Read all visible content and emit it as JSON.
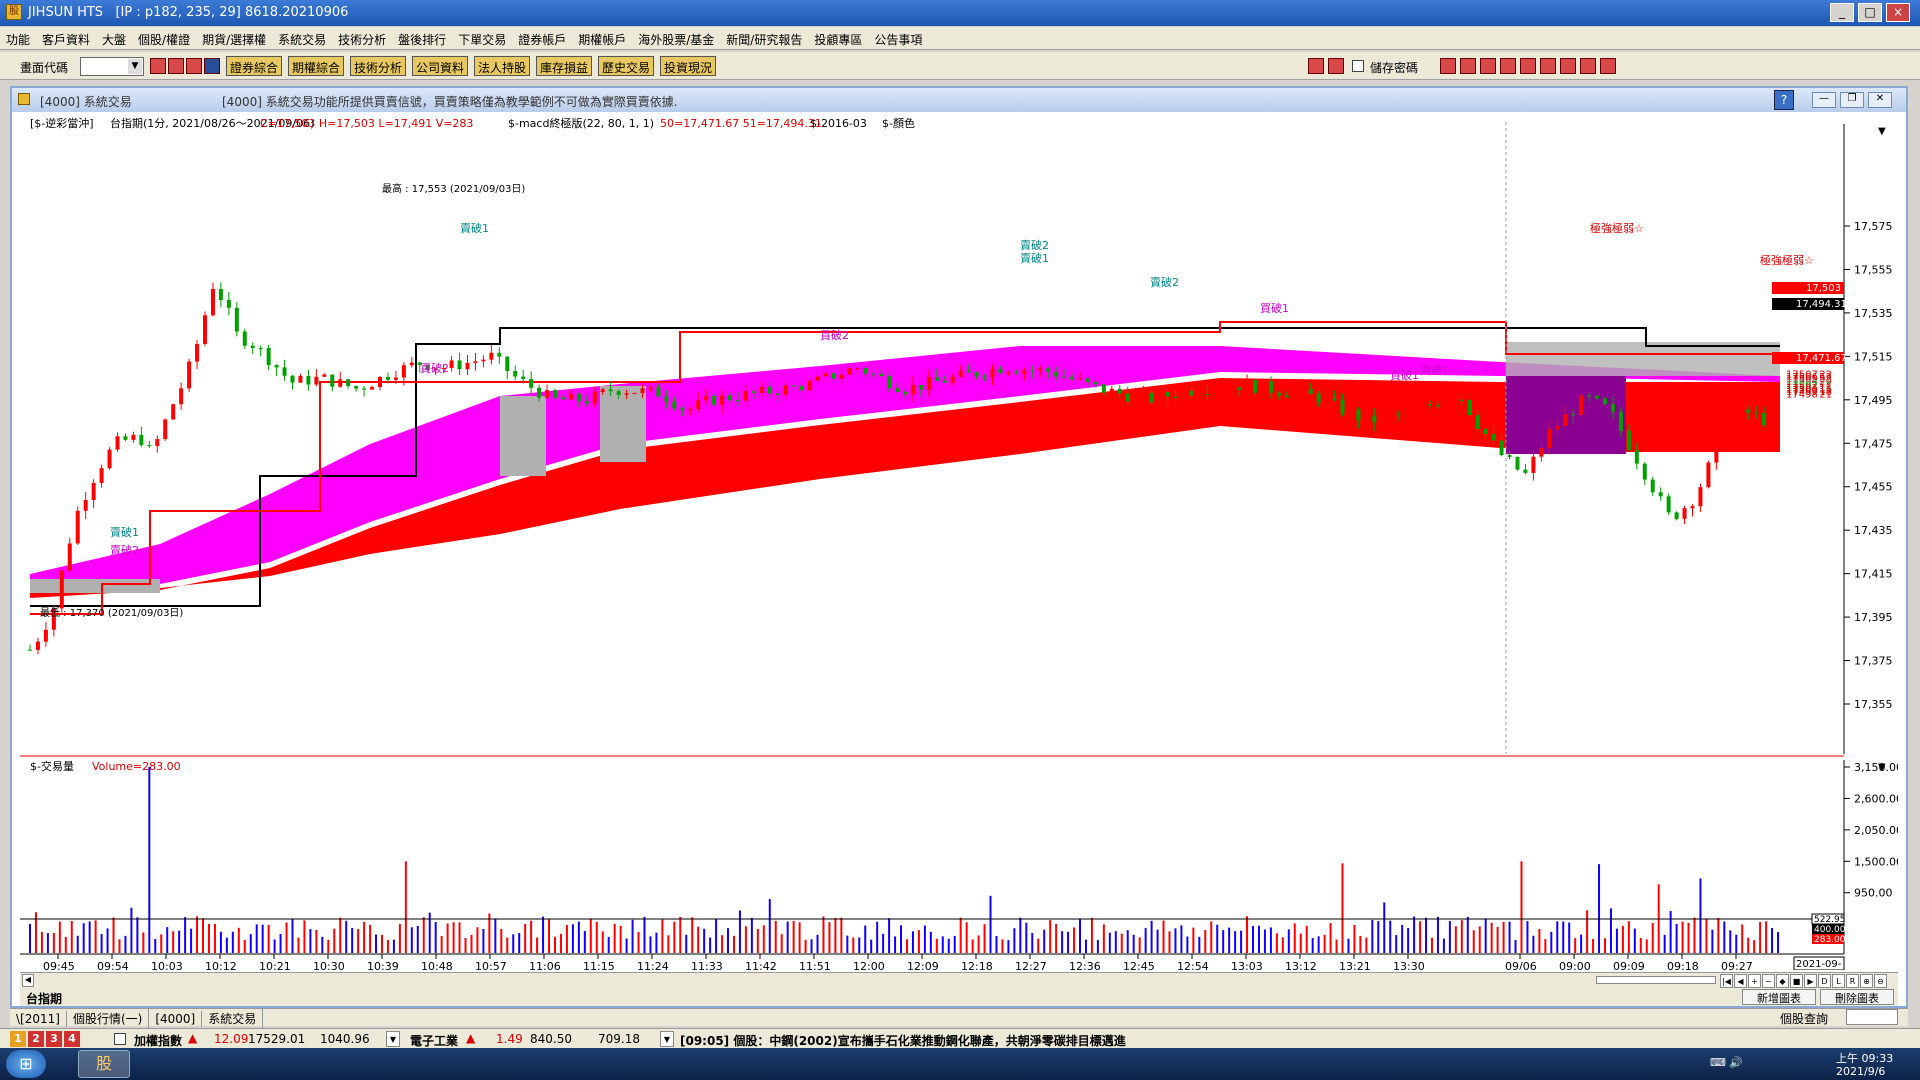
{
  "window": {
    "app_icon": "股",
    "title": "JIHSUN HTS",
    "conn": "[IP : p182, 235, 29]  8618.20210906"
  },
  "menu": [
    "功能",
    "客戶資料",
    "大盤",
    "個股/權證",
    "期貨/選擇權",
    "系統交易",
    "技術分析",
    "盤後排行",
    "下單交易",
    "證券帳戶",
    "期權帳戶",
    "海外股票/基金",
    "新聞/研究報告",
    "投顧專區",
    "公告事項"
  ],
  "toolbar": {
    "label": "畫面代碼",
    "buttons": [
      "證券綜合",
      "期權綜合",
      "技術分析",
      "公司資料",
      "法人持股",
      "庫存損益",
      "歷史交易",
      "投資現況"
    ],
    "save_pwd": "儲存密碼"
  },
  "mdi": {
    "code": "[4000]  系統交易",
    "notice": "[4000] 系統交易功能所提供買賣信號，買賣策略僅為教學範例不可做為實際買賣依據.",
    "help": "?"
  },
  "chart": {
    "header": {
      "a": "[$-逆彩當沖]",
      "b": "台指期(1分, 2021/08/26～2021/09/06)",
      "c": "C=17,503 H=17,503 L=17,491 V=283",
      "d": "$-macd終極版(22, 80, 1, 1)",
      "e": "50=17,471.67 51=17,494.31",
      "f": "$-2016-03",
      "g": "$-顏色"
    },
    "high_label": "最高 : 17,553 (2021/09/03日)",
    "low_label": "最低 : 17,370 (2021/09/03日)",
    "price_ticks": [
      "17,575",
      "17,555",
      "17,535",
      "17,515",
      "17,495",
      "17,475",
      "17,455",
      "17,435",
      "17,415",
      "17,395",
      "17,375",
      "17,355"
    ],
    "price_box_1": "17,503",
    "price_box_2": "17,494.31",
    "price_box_3": "17,471.67",
    "signals": [
      "極強極弱☆",
      "極強極弱☆",
      "賣破2",
      "賣破1",
      "買破2",
      "買破1",
      "賣破2",
      "賣破1",
      "買破1",
      "買破2",
      "買破1",
      "賣破1",
      "賣破2"
    ],
    "book": [
      {
        "p": "17507",
        "q": "22"
      },
      {
        "p": "17506",
        "q": "52"
      },
      {
        "p": "17505",
        "q": "52"
      },
      {
        "p": "17504",
        "q": "20"
      },
      {
        "p": "17503",
        "q": "25"
      },
      {
        "p": "17502",
        "q": "1"
      },
      {
        "p": "17501",
        "q": "11"
      },
      {
        "p": "17500",
        "q": "15"
      },
      {
        "p": "17499",
        "q": "18"
      },
      {
        "p": "17498",
        "q": "21"
      }
    ],
    "vol_header": {
      "a": "$-交易量",
      "b": "Volume=283.00"
    },
    "vol_ticks": [
      "3,150.00",
      "2,600.00",
      "2,050.00",
      "1,500.00",
      "950.00"
    ],
    "vol_box_1": "522.95",
    "vol_box_2": "400.00",
    "vol_box_3": "283.00",
    "time_ticks": [
      "09:45",
      "09:54",
      "10:03",
      "10:12",
      "10:21",
      "10:30",
      "10:39",
      "10:48",
      "10:57",
      "11:06",
      "11:15",
      "11:24",
      "11:33",
      "11:42",
      "11:51",
      "12:00",
      "12:09",
      "12:18",
      "12:27",
      "12:36",
      "12:45",
      "12:54",
      "13:03",
      "13:12",
      "13:21",
      "13:30",
      "09/06",
      "09:00",
      "09:09",
      "09:18",
      "09:27"
    ],
    "date_box": "2021-09-",
    "symbol": "台指期",
    "nav": [
      "|◀",
      "◀",
      "+",
      "−",
      "◆",
      "■",
      "▶",
      "D",
      "L",
      "R",
      "⊕",
      "⊖",
      "▶|"
    ],
    "btn_new": "新增圖表",
    "btn_del": "刪除圖表"
  },
  "tabs": [
    "\\[2011]",
    "個股行情(一)",
    "[4000]",
    "系統交易"
  ],
  "right_status": "個股查詢",
  "status": {
    "nums": [
      "1",
      "2",
      "3",
      "4"
    ],
    "idx1_name": "加權指數",
    "idx1_chg": "12.09",
    "idx1_val": "17529.01",
    "idx1_vol": "1040.96",
    "idx2_name": "電子工業",
    "idx2_chg": "1.49",
    "idx2_val": "840.50",
    "idx2_vol": "709.18",
    "news": "[09:05] 個股：中鋼(2002)宣布攜手石化業推動鋼化聯產，共朝淨零碳排目標邁進"
  },
  "taskbar": {
    "start": "⊞",
    "app": "股",
    "time": "上午 09:33",
    "date": "2021/9/6"
  },
  "colors": {
    "magenta": "#ff00ff",
    "red": "#ff0000",
    "gray": "#b0b0b0",
    "purple": "#8a0090",
    "up": "#ff0000",
    "down": "#1000ff",
    "green": "#00a000"
  }
}
